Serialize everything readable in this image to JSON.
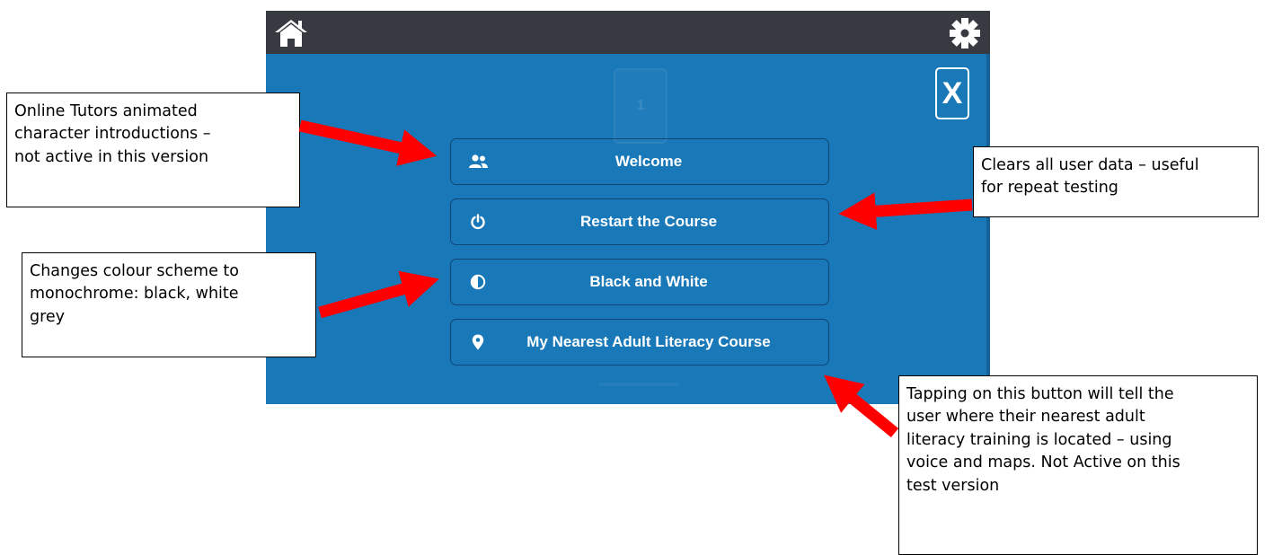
{
  "app": {
    "ghost_tile_text": "1",
    "close_label": "X",
    "menu": [
      {
        "label": "Welcome",
        "icon": "users-icon"
      },
      {
        "label": "Restart the Course",
        "icon": "power-icon"
      },
      {
        "label": "Black and White",
        "icon": "contrast-icon"
      },
      {
        "label": "My Nearest Adult Literacy Course",
        "icon": "map-marker-icon"
      }
    ]
  },
  "annotations": {
    "tutors": [
      "Online Tutors animated",
      "character introductions –",
      "not active in this version"
    ],
    "clears": [
      "Clears all user data – useful",
      "for repeat testing"
    ],
    "colour": [
      "Changes colour scheme to",
      "monochrome: black, white",
      "grey"
    ],
    "nearest": [
      "Tapping on this button will tell the",
      "user where their nearest adult",
      "literacy training is located – using",
      "voice and maps. Not Active on this",
      "test version"
    ]
  },
  "colors": {
    "app_background": "#1978b8",
    "top_bar": "#373a40",
    "arrow": "#ff0000"
  }
}
